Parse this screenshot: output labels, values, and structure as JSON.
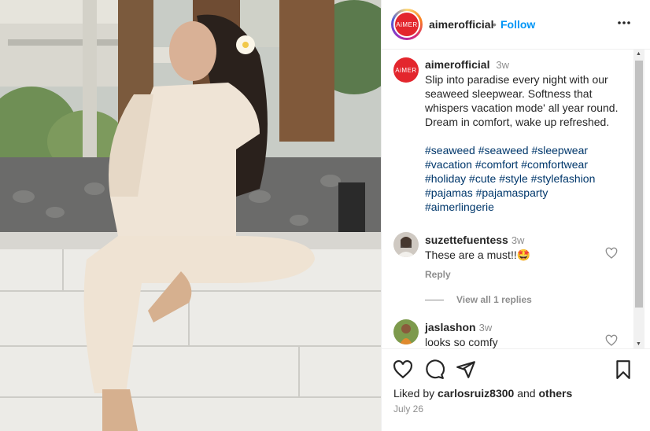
{
  "post": {
    "username": "aimerofficial",
    "dot": "•",
    "follow_label": "Follow",
    "brand_text": "AiMER",
    "caption_time": "3w",
    "caption_lines": [
      "Slip into paradise every night with our",
      "seaweed sleepwear. Softness that",
      "whispers vacation mode' all year round.",
      "Dream in comfort, wake up refreshed."
    ],
    "hashtags": [
      "#seaweed",
      "#seaweed",
      "#sleepwear",
      "#vacation",
      "#comfort",
      "#comfortwear",
      "#holiday",
      "#cute",
      "#style",
      "#stylefashion",
      "#pajamas",
      "#pajamasparty",
      "#aimerlingerie"
    ]
  },
  "comments": [
    {
      "user": "suzettefuentess",
      "time": "3w",
      "text": "These are a must!!",
      "emoji": "🤩",
      "reply_label": "Reply",
      "view_replies": "View all 1 replies"
    },
    {
      "user": "jaslashon",
      "time": "3w",
      "text": "looks so comfy"
    }
  ],
  "footer": {
    "liked_prefix": "Liked by",
    "liked_user": "carlosruiz8300",
    "liked_and": "and",
    "liked_others": "others",
    "date": "July 26"
  },
  "icons": [
    "more-icon",
    "heart-icon",
    "comment-icon",
    "share-icon",
    "bookmark-icon"
  ],
  "colors": {
    "accent": "#0095f6",
    "brand": "#e3262d",
    "hashtag": "#00376b",
    "muted": "#8e8e8e"
  }
}
